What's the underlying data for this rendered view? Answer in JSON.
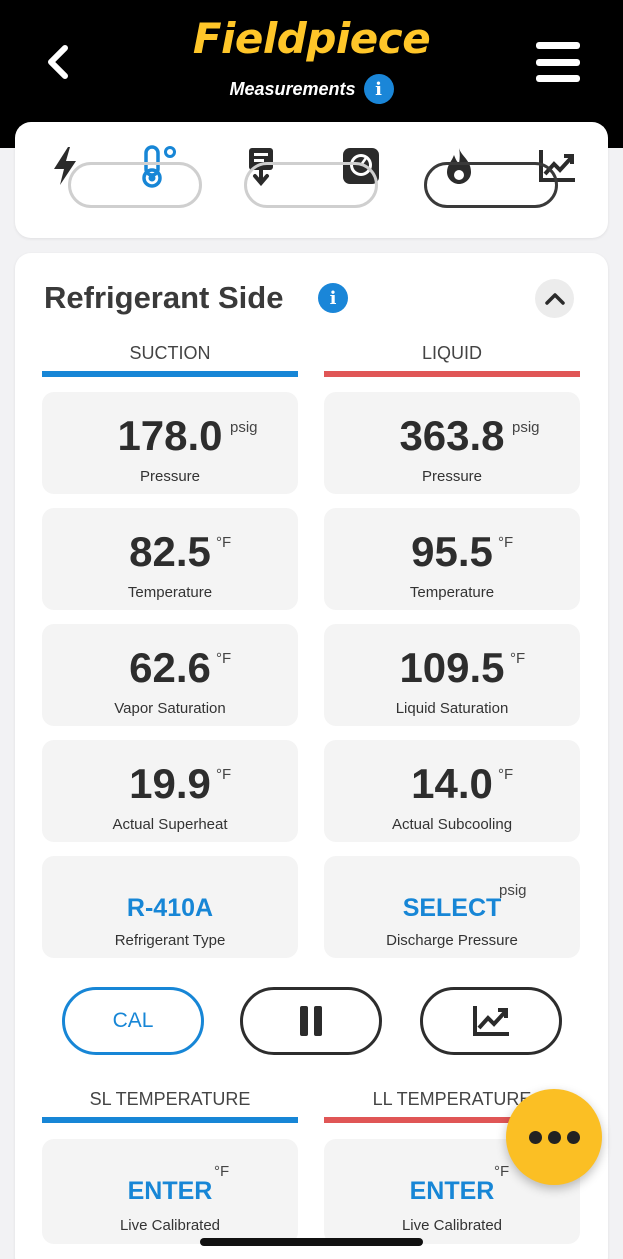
{
  "header": {
    "brand": "Fieldpiece",
    "subtitle": "Measurements",
    "info_glyph": "i"
  },
  "tabs": [
    "electrical-icon",
    "temperature-icon",
    "condenser-icon",
    "gauge-icon",
    "flame-icon",
    "trend-chart-icon"
  ],
  "section": {
    "title": "Refrigerant Side",
    "info_glyph": "i"
  },
  "columns": {
    "suction": "SUCTION",
    "liquid": "LIQUID"
  },
  "suction": [
    {
      "value": "178.0",
      "unit": "psig",
      "label": "Pressure"
    },
    {
      "value": "82.5",
      "unit": "°F",
      "label": "Temperature"
    },
    {
      "value": "62.6",
      "unit": "°F",
      "label": "Vapor Saturation"
    },
    {
      "value": "19.9",
      "unit": "°F",
      "label": "Actual Superheat"
    },
    {
      "value": "R-410A",
      "unit": "",
      "label": "Refrigerant Type"
    }
  ],
  "liquid": [
    {
      "value": "363.8",
      "unit": "psig",
      "label": "Pressure"
    },
    {
      "value": "95.5",
      "unit": "°F",
      "label": "Temperature"
    },
    {
      "value": "109.5",
      "unit": "°F",
      "label": "Liquid Saturation"
    },
    {
      "value": "14.0",
      "unit": "°F",
      "label": "Actual Subcooling"
    },
    {
      "value": "SELECT",
      "unit": "psig",
      "label": "Discharge Pressure"
    }
  ],
  "actions": {
    "cal_label": "CAL"
  },
  "lower_columns": {
    "sl": "SL TEMPERATURE",
    "ll": "LL TEMPERATURE"
  },
  "sl_cell": {
    "value": "ENTER",
    "unit": "°F",
    "label": "Live Calibrated"
  },
  "ll_cell": {
    "value": "ENTER",
    "unit": "°F",
    "label": "Live Calibrated"
  },
  "colors": {
    "brand": "#ffc629",
    "suction": "#1786d6",
    "liquid": "#e05656",
    "fab": "#fbbf24"
  }
}
